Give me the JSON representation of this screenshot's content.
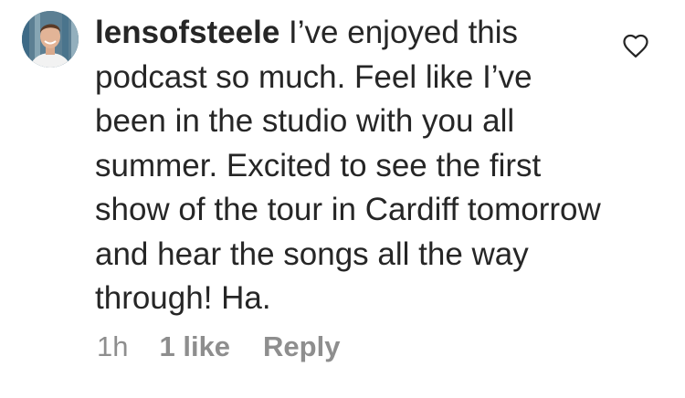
{
  "comment": {
    "username": "lensofsteele",
    "text": "I’ve enjoyed this podcast so much. Feel like I’ve been in the studio with you all summer. Excited to see the first show of the tour in Cardiff tomorrow and hear the songs all the way through! Ha.",
    "time": "1h",
    "likes": "1 like",
    "reply_label": "Reply",
    "like_icon": "heart-outline-icon",
    "avatar_icon": "user-avatar"
  },
  "colors": {
    "text": "#262626",
    "muted": "#8e8e8e",
    "background": "#ffffff"
  }
}
